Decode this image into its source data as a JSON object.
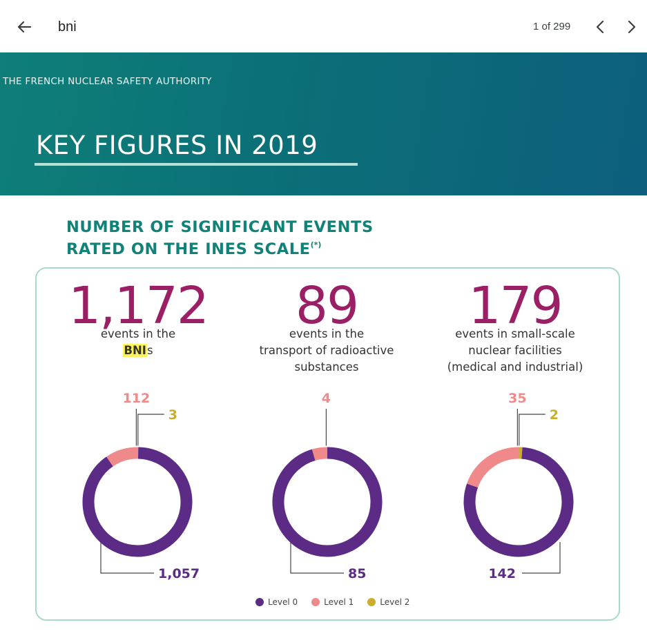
{
  "search": {
    "query": "bni",
    "match_count": "1 of 299"
  },
  "banner": {
    "authority": "THE FRENCH NUCLEAR SAFETY AUTHORITY",
    "title": "KEY FIGURES IN 2019"
  },
  "section": {
    "title_line1": "NUMBER OF SIGNIFICANT EVENTS",
    "title_line2": "RATED ON THE INES SCALE",
    "title_sup": "(*)"
  },
  "stats": [
    {
      "number": "1,172",
      "desc_line1": "events in the",
      "desc_highlight": "BNI",
      "desc_suffix": "s"
    },
    {
      "number": "89",
      "desc_line1": "events in the",
      "desc_line2": "transport of radioactive",
      "desc_line3": "substances"
    },
    {
      "number": "179",
      "desc_line1": "events in small-scale",
      "desc_line2": "nuclear facilities",
      "desc_line3": "(medical and industrial)"
    }
  ],
  "colors": {
    "level0": "#5b2b86",
    "level1": "#f08a8a",
    "level2": "#c9ad2b",
    "banner": "#0d7377",
    "heading": "#118277",
    "big_number": "#9a1f64"
  },
  "chart_data": [
    {
      "type": "pie",
      "categories": [
        "Level 0",
        "Level 1",
        "Level 2"
      ],
      "values": [
        1057,
        112,
        3
      ],
      "labels": {
        "level0": "1,057",
        "level1": "112",
        "level2": "3"
      }
    },
    {
      "type": "pie",
      "categories": [
        "Level 0",
        "Level 1",
        "Level 2"
      ],
      "values": [
        85,
        4,
        0
      ],
      "labels": {
        "level0": "85",
        "level1": "4"
      }
    },
    {
      "type": "pie",
      "categories": [
        "Level 0",
        "Level 1",
        "Level 2"
      ],
      "values": [
        142,
        35,
        2
      ],
      "labels": {
        "level0": "142",
        "level1": "35",
        "level2": "2"
      }
    }
  ],
  "legend": [
    {
      "label": "Level 0",
      "color": "#5b2b86"
    },
    {
      "label": "Level 1",
      "color": "#f08a8a"
    },
    {
      "label": "Level 2",
      "color": "#c9ad2b"
    }
  ]
}
